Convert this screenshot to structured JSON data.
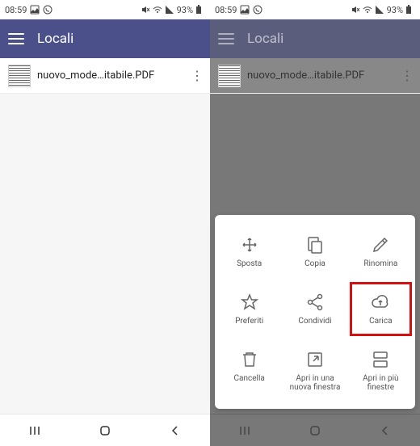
{
  "status": {
    "time": "08:59",
    "battery_pct": "93%",
    "icons_left": [
      "image-icon",
      "whatsapp-icon"
    ],
    "icons_right": [
      "mute-icon",
      "wifi-icon",
      "signal-icon"
    ]
  },
  "header": {
    "title": "Locali"
  },
  "file": {
    "name": "nuovo_mode…itabile.PDF",
    "more_glyph": "⋮"
  },
  "sheet": {
    "actions": [
      {
        "id": "sposta",
        "label": "Sposta",
        "icon": "move-icon"
      },
      {
        "id": "copia",
        "label": "Copia",
        "icon": "copy-icon"
      },
      {
        "id": "rinomina",
        "label": "Rinomina",
        "icon": "pencil-icon"
      },
      {
        "id": "preferiti",
        "label": "Preferiti",
        "icon": "star-icon"
      },
      {
        "id": "condividi",
        "label": "Condividi",
        "icon": "share-icon"
      },
      {
        "id": "carica",
        "label": "Carica",
        "icon": "cloud-icon",
        "highlighted": true
      },
      {
        "id": "cancella",
        "label": "Cancella",
        "icon": "trash-icon"
      },
      {
        "id": "apri-nuova",
        "label": "Apri in una nuova finestra",
        "icon": "open-external-icon"
      },
      {
        "id": "apri-piu",
        "label": "Apri in più finestre",
        "icon": "split-windows-icon"
      }
    ]
  },
  "nav": {
    "recents_glyph": "|||",
    "home_glyph": "◯",
    "back_glyph": "‹"
  }
}
